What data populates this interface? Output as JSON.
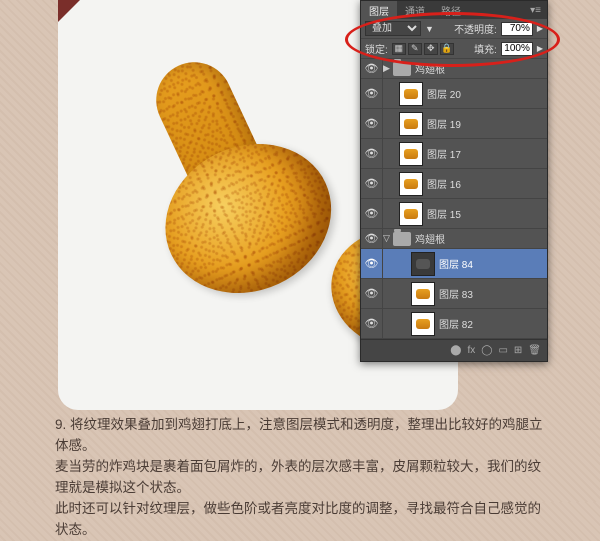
{
  "corner_decoration": "triangle-maroon",
  "panel": {
    "tabs": [
      "图层",
      "通道",
      "路径"
    ],
    "active_tab": 0,
    "blend_mode": "叠加",
    "opacity_label": "不透明度:",
    "opacity_value": "70%",
    "lock_label": "锁定:",
    "fill_label": "填充:",
    "fill_value": "100%",
    "groups": [
      {
        "name": "鸡翅根",
        "expanded": false
      },
      {
        "name": "鸡翅根",
        "expanded": true
      }
    ],
    "layers": [
      {
        "name": "图层 20",
        "visible": true
      },
      {
        "name": "图层 19",
        "visible": true
      },
      {
        "name": "图层 17",
        "visible": true
      },
      {
        "name": "图层 16",
        "visible": true
      },
      {
        "name": "图层 15",
        "visible": true
      }
    ],
    "sublayers": [
      {
        "name": "图层 84",
        "visible": true,
        "selected": true,
        "thumb": "dark"
      },
      {
        "name": "图层 83",
        "visible": true,
        "thumb": "light"
      },
      {
        "name": "图层 82",
        "visible": true,
        "thumb": "light"
      }
    ]
  },
  "caption": {
    "step": "9.",
    "line1": "将纹理效果叠加到鸡翅打底上，注意图层模式和透明度，整理出比较好的鸡腿立体感。",
    "line2": "麦当劳的炸鸡块是裹着面包屑炸的，外表的层次感丰富，皮屑颗粒较大，我们的纹理就是模拟这个状态。",
    "line3": "此时还可以针对纹理层，做些色阶或者亮度对比度的调整，寻找最符合自己感觉的状态。"
  }
}
